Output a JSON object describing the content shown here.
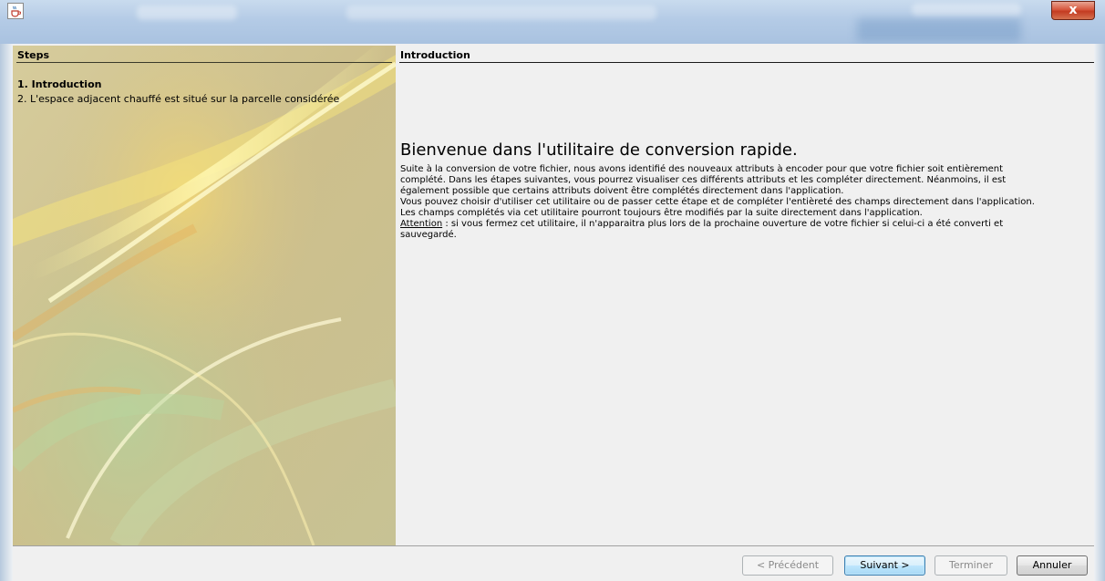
{
  "window": {
    "close_symbol": "x",
    "app_icon": "java-cup-icon",
    "close_icon": "close-icon"
  },
  "steps": {
    "title": "Steps",
    "items": [
      {
        "label": "1. Introduction",
        "current": true
      },
      {
        "label": "2. L'espace adjacent chauffé est situé sur la parcelle considérée",
        "current": false
      }
    ]
  },
  "content": {
    "title": "Introduction",
    "welcome": "Bienvenue dans l'utilitaire de conversion rapide.",
    "lines": [
      "Suite à la conversion de votre fichier, nous avons identifié des nouveaux attributs à encoder pour que votre fichier soit entièrement",
      "complété. Dans les étapes suivantes, vous pourrez visualiser ces différents attributs et les compléter directement. Néanmoins, il est",
      "également possible que certains attributs doivent être complétés directement dans l'application.",
      "Vous pouvez choisir d'utiliser cet utilitaire ou de passer cette étape et de compléter l'entièreté des champs directement dans l'application.",
      "Les champs complétés via cet utilitaire pourront toujours être modifiés par la suite directement dans l'application."
    ],
    "attention_label": "Attention",
    "attention_line1": " : si vous fermez cet utilitaire, il n'apparaitra plus lors de la prochaine ouverture de votre fichier si celui-ci a été converti et",
    "attention_line2": "sauvegardé."
  },
  "buttons": {
    "previous": "< Précédent",
    "next": "Suivant >",
    "finish": "Terminer",
    "cancel": "Annuler"
  },
  "colors": {
    "steps_bg": "#cfc493",
    "accent_focus": "#3c7fb1",
    "close_red": "#c33b21"
  }
}
